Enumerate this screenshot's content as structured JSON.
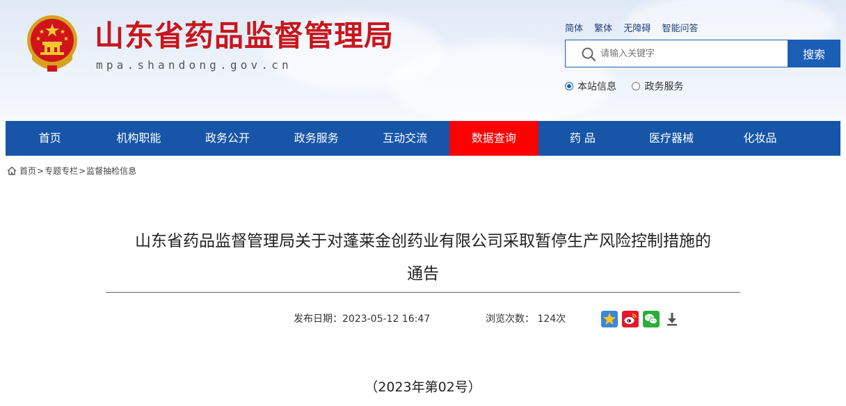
{
  "header": {
    "site_title": "山东省药品监督管理局",
    "site_domain": "mpa.shandong.gov.cn",
    "lang_links": [
      "简体",
      "繁体",
      "无障碍",
      "智能问答"
    ],
    "search": {
      "placeholder": "请输入关键字",
      "button_label": "搜索"
    },
    "scope_options": [
      {
        "label": "本站信息",
        "selected": true
      },
      {
        "label": "政务服务",
        "selected": false
      }
    ]
  },
  "nav": {
    "items": [
      {
        "label": "首页",
        "active": false
      },
      {
        "label": "机构职能",
        "active": false
      },
      {
        "label": "政务公开",
        "active": false
      },
      {
        "label": "政务服务",
        "active": false
      },
      {
        "label": "互动交流",
        "active": false
      },
      {
        "label": "数据查询",
        "active": true
      },
      {
        "label": "药 品",
        "active": false
      },
      {
        "label": "医疗器械",
        "active": false
      },
      {
        "label": "化妆品",
        "active": false
      }
    ]
  },
  "breadcrumb": {
    "items": [
      "首页",
      "专题专栏",
      "监督抽检信息"
    ],
    "separator": ">"
  },
  "article": {
    "title_line1": "山东省药品监督管理局关于对蓬莱金创药业有限公司采取暂停生产风险控制措施的",
    "title_line2": "通告",
    "publish_label": "发布日期：",
    "publish_date": "2023-05-12 16:47",
    "views_label": "浏览次数：",
    "views_count": "124次",
    "doc_number": "（2023年第02号）"
  },
  "share_icons": [
    "favorite-star-icon",
    "weibo-icon",
    "wechat-icon",
    "download-icon"
  ],
  "colors": {
    "brand_red": "#c8161d",
    "nav_blue": "#1655a8",
    "nav_active": "#fe0000",
    "search_blue": "#1a5eb6"
  }
}
